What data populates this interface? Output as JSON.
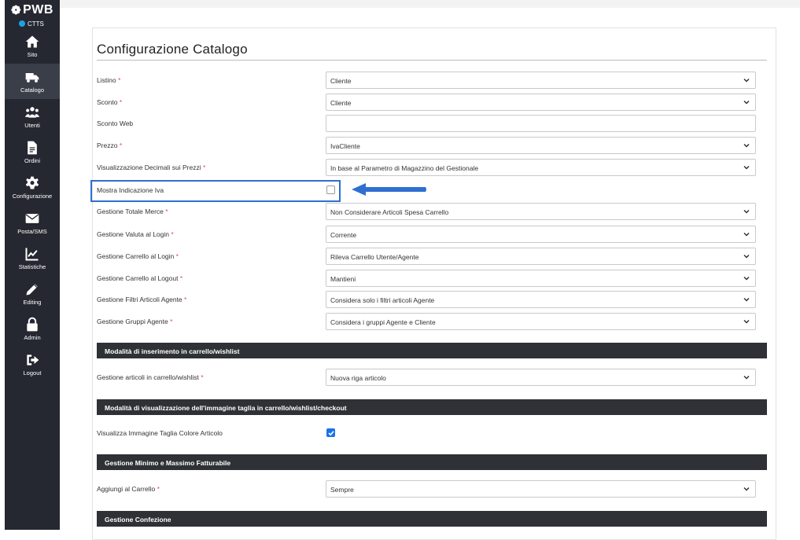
{
  "sidebar": {
    "brand": "PWB",
    "env_label": "CTTS",
    "items": [
      {
        "label": "Sito",
        "icon": "home-icon",
        "active": false
      },
      {
        "label": "Catalogo",
        "icon": "truck-icon",
        "active": true
      },
      {
        "label": "Utenti",
        "icon": "users-icon",
        "active": false
      },
      {
        "label": "Ordini",
        "icon": "document-icon",
        "active": false
      },
      {
        "label": "Configurazione",
        "icon": "gear-icon",
        "active": false
      },
      {
        "label": "Posta/SMS",
        "icon": "mail-icon",
        "active": false
      },
      {
        "label": "Statistiche",
        "icon": "chart-icon",
        "active": false
      },
      {
        "label": "Editing",
        "icon": "pencil-icon",
        "active": false
      },
      {
        "label": "Admin",
        "icon": "lock-icon",
        "active": false
      },
      {
        "label": "Logout",
        "icon": "logout-icon",
        "active": false
      }
    ]
  },
  "page": {
    "title": "Configurazione Catalogo",
    "fields": [
      {
        "label": "Listino",
        "required": true,
        "type": "select",
        "value": "Cliente"
      },
      {
        "label": "Sconto",
        "required": true,
        "type": "select",
        "value": "Cliente"
      },
      {
        "label": "Sconto Web",
        "required": false,
        "type": "text",
        "value": ""
      },
      {
        "label": "Prezzo",
        "required": true,
        "type": "select",
        "value": "IvaCliente"
      },
      {
        "label": "Visualizzazione Decimali sui Prezzi",
        "required": true,
        "type": "select",
        "value": "In base al Parametro di Magazzino del Gestionale"
      },
      {
        "label": "Mostra Indicazione Iva",
        "required": false,
        "type": "checkbox",
        "checked": false
      },
      {
        "label": "Gestione Totale Merce",
        "required": true,
        "type": "select",
        "value": "Non Considerare Articoli Spesa Carrello"
      },
      {
        "label": "Gestione Valuta al Login",
        "required": true,
        "type": "select",
        "value": "Corrente"
      },
      {
        "label": "Gestione Carrello al Login",
        "required": true,
        "type": "select",
        "value": "Rileva Carrello Utente/Agente"
      },
      {
        "label": "Gestione Carrello al Logout",
        "required": true,
        "type": "select",
        "value": "Mantieni"
      },
      {
        "label": "Gestione Filtri Articoli Agente",
        "required": true,
        "type": "select",
        "value": "Considera solo i filtri articoli Agente"
      },
      {
        "label": "Gestione Gruppi Agente",
        "required": true,
        "type": "select",
        "value": "Considera i gruppi Agente e Cliente"
      }
    ],
    "sections": [
      {
        "title": "Modalità di inserimento in carrello/wishlist",
        "fields": [
          {
            "label": "Gestione articoli in carrello/wishlist",
            "required": true,
            "type": "select",
            "value": "Nuova riga articolo"
          }
        ]
      },
      {
        "title": "Modalità di visualizzazione dell'immagine taglia in carrello/wishlist/checkout",
        "fields": [
          {
            "label": "Visualizza Immagine Taglia Colore Articolo",
            "required": false,
            "type": "checkbox",
            "checked": true
          }
        ]
      },
      {
        "title": "Gestione Minimo e Massimo Fatturabile",
        "fields": [
          {
            "label": "Aggiungi al Carrello",
            "required": true,
            "type": "select",
            "value": "Sempre"
          }
        ]
      },
      {
        "title": "Gestione Confezione",
        "fields": []
      }
    ]
  },
  "colors": {
    "sidebar_bg": "#252830",
    "accent_blue": "#1a73e8",
    "highlight_blue": "#2f6fd1",
    "section_bar_bg": "#2f3136",
    "required_red": "#d9534f"
  },
  "required_mark": "*"
}
